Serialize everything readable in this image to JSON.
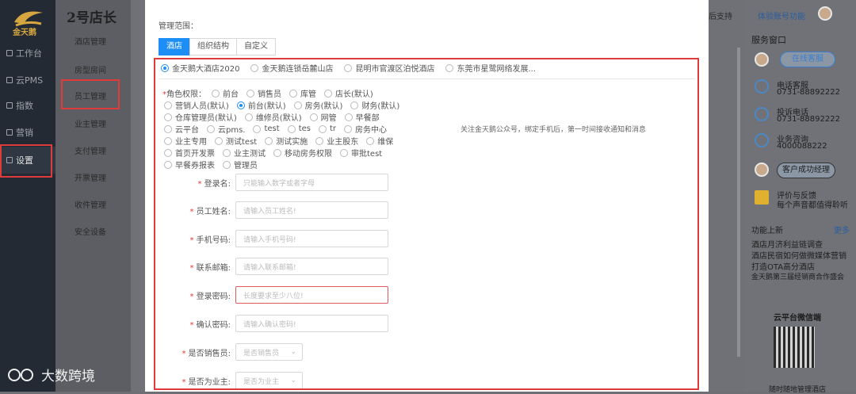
{
  "app": {
    "logo_text": "金天鹅",
    "store_name": "2号店长"
  },
  "left_nav": [
    {
      "label": "工作台"
    },
    {
      "label": "云PMS"
    },
    {
      "label": "指数"
    },
    {
      "label": "营销"
    },
    {
      "label": "设置"
    }
  ],
  "sub_nav": [
    "酒店管理",
    "房型房间",
    "员工管理",
    "业主管理",
    "支付管理",
    "开票管理",
    "收件管理",
    "安全设备"
  ],
  "right_panel": {
    "top_link": "体验账号功能",
    "top_left": "后支持",
    "service_title": "服务窗口",
    "online_service": "在线客服",
    "phone_label": "电话客服",
    "phone_number": "0731-88892222",
    "complaint_label": "投诉电话",
    "complaint_number": "0731-88892222",
    "business_label": "业务咨询",
    "business_number": "4000088222",
    "success_manager": "客户成功经理",
    "feedback_title": "评价与反馈",
    "feedback_sub": "每个声音都值得聆听",
    "news_title": "功能上新",
    "news_more": "更多",
    "news": [
      "酒店月济利益链调查",
      "酒店民宿如何做微媒体营销",
      "打造OTA高分酒店",
      "金天鹅第三届经销商合作盛会"
    ],
    "wechat_title": "云平台微信端",
    "wechat_sub": "随时随地管理酒店"
  },
  "modal": {
    "range_label": "管理范围：",
    "tabs": [
      "酒店",
      "组织结构",
      "自定义"
    ],
    "hotels": [
      "金天鹅大酒店2020",
      "金天鹅连锁岳麓山店",
      "昆明市官渡区泊悦酒店",
      "东莞市星鹭网络发展..."
    ],
    "roles_label": "角色权限：",
    "role_lines": [
      [
        "前台",
        "销售员",
        "库管",
        "店长(默认)"
      ],
      [
        "营销人员(默认)",
        "前台(默认)",
        "房务(默认)",
        "财务(默认)"
      ],
      [
        "仓库管理员(默认)",
        "维修员(默认)",
        "网管",
        "早餐部"
      ],
      [
        "云平台",
        "云pms.",
        "test",
        "tes",
        "tr",
        "房务中心"
      ],
      [
        "业主专用",
        "测试test",
        "测试实施",
        "业主股东",
        "维保"
      ],
      [
        "首页开发票",
        "业主测试",
        "移动房务权限",
        "审批test"
      ],
      [
        "早餐券报表",
        "管理员"
      ]
    ],
    "notice": "关注金天鹅公众号，绑定手机后，第一时间接收通知和消息",
    "fields": [
      {
        "label": "登录名:",
        "placeholder": "只能输入数字或者字母"
      },
      {
        "label": "员工姓名:",
        "placeholder": "请输入员工姓名!"
      },
      {
        "label": "手机号码:",
        "placeholder": "请输入手机号码!"
      },
      {
        "label": "联系邮箱:",
        "placeholder": "请输入联系邮箱!"
      },
      {
        "label": "登录密码:",
        "placeholder": "长度要求至少八位!"
      },
      {
        "label": "确认密码:",
        "placeholder": "请输入确认密码!"
      }
    ],
    "selects": [
      {
        "label": "是否销售员:",
        "value": "是否销售员"
      },
      {
        "label": "是否为业主:",
        "value": "是否为业主"
      }
    ]
  },
  "watermark": "大数跨境"
}
